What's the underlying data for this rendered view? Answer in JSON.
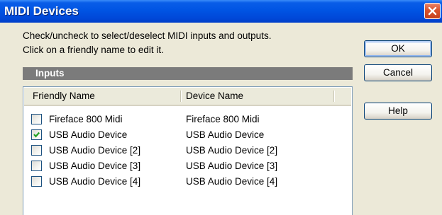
{
  "window": {
    "title": "MIDI Devices"
  },
  "instructions": {
    "line1": "Check/uncheck to select/deselect MIDI inputs and outputs.",
    "line2": "Click on a friendly name to edit it."
  },
  "inputs_section": {
    "label": "Inputs",
    "columns": [
      "Friendly Name",
      "Device Name"
    ],
    "rows": [
      {
        "checked": false,
        "friendly_name": "Fireface 800 Midi",
        "device_name": "Fireface 800 Midi"
      },
      {
        "checked": true,
        "friendly_name": "USB Audio Device",
        "device_name": "USB Audio Device"
      },
      {
        "checked": false,
        "friendly_name": "USB Audio Device [2]",
        "device_name": "USB Audio Device [2]"
      },
      {
        "checked": false,
        "friendly_name": "USB Audio Device [3]",
        "device_name": "USB Audio Device [3]"
      },
      {
        "checked": false,
        "friendly_name": "USB Audio Device [4]",
        "device_name": "USB Audio Device [4]"
      }
    ]
  },
  "buttons": {
    "ok": "OK",
    "cancel": "Cancel",
    "help": "Help"
  },
  "colors": {
    "title_bar": "#0054e3",
    "section_bar": "#7b7b7b",
    "check_mark": "#21a121",
    "close_button": "#d9522c"
  },
  "icons": {
    "close": "close-icon",
    "check": "checkmark-icon"
  }
}
